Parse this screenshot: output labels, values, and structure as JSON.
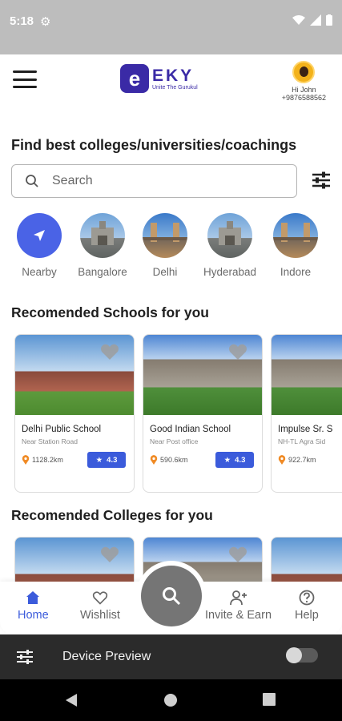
{
  "status_bar": {
    "time": "5:18"
  },
  "header": {
    "logo_letter": "e",
    "logo_name": "EKY",
    "logo_tagline": "Unite The Gurukul",
    "greeting": "Hi John",
    "phone": "+9876588562"
  },
  "find": {
    "title": "Find best colleges/universities/coachings",
    "search_placeholder": "Search"
  },
  "cities": [
    {
      "label": "Nearby"
    },
    {
      "label": "Bangalore"
    },
    {
      "label": "Delhi"
    },
    {
      "label": "Hyderabad"
    },
    {
      "label": "Indore"
    }
  ],
  "schools": {
    "title": "Recomended Schools for you",
    "cards": [
      {
        "name": "Delhi Public School",
        "address": "Near Station Road",
        "distance": "1128.2km",
        "rating": "4.3"
      },
      {
        "name": "Good Indian School",
        "address": "Near Post office",
        "distance": "590.6km",
        "rating": "4.3"
      },
      {
        "name": "Impulse Sr. S",
        "address": "NH-TL Agra Sid",
        "distance": "922.7km",
        "rating": ""
      }
    ]
  },
  "colleges": {
    "title": "Recomended Colleges for you"
  },
  "bottom_nav": {
    "home": "Home",
    "wishlist": "Wishlist",
    "invite": "Invite & Earn",
    "help": "Help"
  },
  "device_preview": {
    "title": "Device Preview"
  },
  "colors": {
    "accent": "#3b5bdb",
    "logo": "#3a2aa6",
    "fab": "#757575"
  }
}
